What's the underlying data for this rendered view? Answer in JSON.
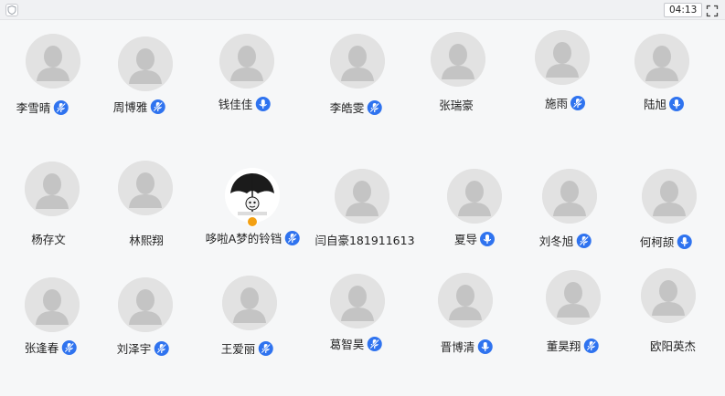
{
  "toolbar": {
    "timer": "04:13",
    "icons": {
      "left": "shield-icon",
      "right": "fullscreen-icon"
    }
  },
  "colors": {
    "mic": "#2f73ef",
    "mic_muted": "#2f73ef",
    "badge": "#f3a012",
    "avatar_bg": "#e2e2e2"
  },
  "participants": [
    {
      "name": "李雪晴",
      "mic": "muted"
    },
    {
      "name": "周博雅",
      "mic": "muted"
    },
    {
      "name": "钱佳佳",
      "mic": "on"
    },
    {
      "name": "李皓雯",
      "mic": "muted"
    },
    {
      "name": "张瑞豪",
      "mic": "none"
    },
    {
      "name": "施雨",
      "mic": "muted"
    },
    {
      "name": "陆旭",
      "mic": "on"
    },
    {
      "name": "杨存文",
      "mic": "none"
    },
    {
      "name": "林熙翔",
      "mic": "none"
    },
    {
      "name": "哆啦A梦的铃铛",
      "mic": "muted",
      "photo": "umbrella-meme",
      "badge": "host-badge"
    },
    {
      "name": "闫自豪181911613",
      "mic": "none"
    },
    {
      "name": "夏导",
      "mic": "on"
    },
    {
      "name": "刘冬旭",
      "mic": "muted"
    },
    {
      "name": "何柯颉",
      "mic": "on"
    },
    {
      "name": "张逢春",
      "mic": "muted"
    },
    {
      "name": "刘泽宇",
      "mic": "muted"
    },
    {
      "name": "王爱丽",
      "mic": "muted"
    },
    {
      "name": "葛智昊",
      "mic": "muted"
    },
    {
      "name": "晋博清",
      "mic": "on"
    },
    {
      "name": "董昊翔",
      "mic": "muted"
    },
    {
      "name": "欧阳英杰",
      "mic": "none"
    }
  ]
}
